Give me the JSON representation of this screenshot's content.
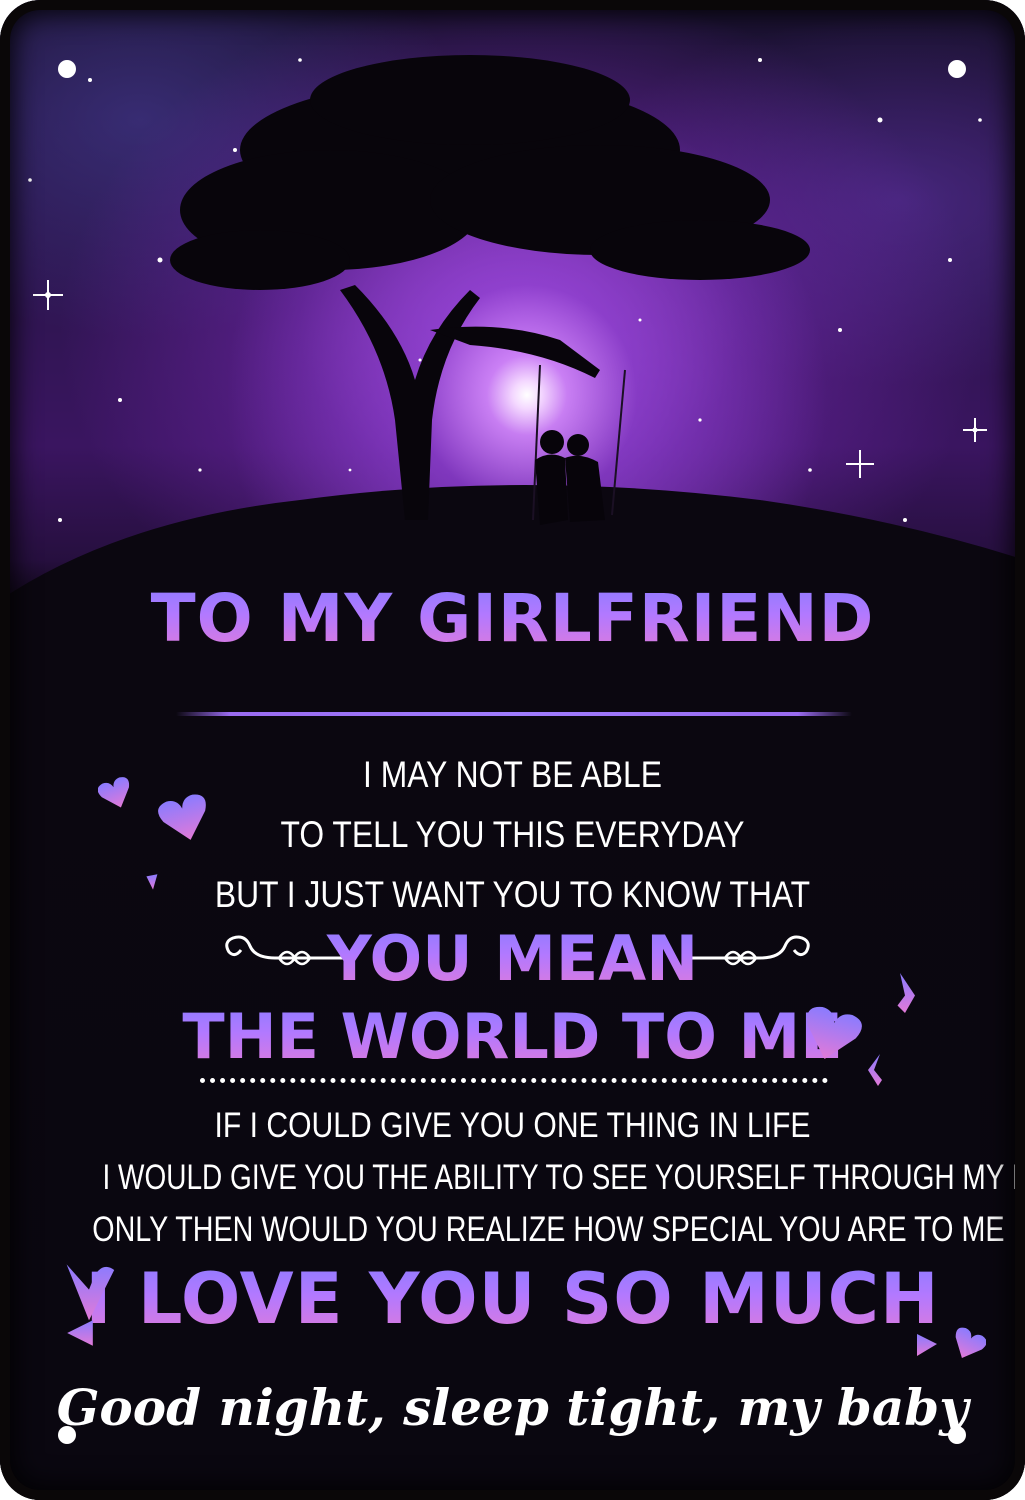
{
  "title": "TO MY GIRLFRIEND",
  "intro": [
    "I MAY NOT BE ABLE",
    "TO TELL YOU THIS EVERYDAY",
    "BUT I JUST WANT YOU TO KNOW THAT"
  ],
  "emphasis": [
    "YOU MEAN",
    "THE WORLD TO ME"
  ],
  "paragraph": [
    "IF I COULD GIVE YOU ONE THING IN LIFE",
    "I WOULD GIVE YOU THE ABILITY TO SEE YOURSELF THROUGH MY EYES",
    "ONLY THEN WOULD YOU REALIZE HOW SPECIAL YOU ARE TO ME"
  ],
  "love_line": "I LOVE YOU SO MUCH",
  "closing": "Good night, sleep tight, my baby",
  "colors": {
    "heading_gradient_top": "#8a7bff",
    "heading_gradient_bottom": "#e27ad8",
    "background": "#0b0710",
    "sky_purple": "#a848de"
  },
  "icons": [
    "heart-icon",
    "flourish-ornament",
    "tree-silhouette",
    "couple-on-swing"
  ]
}
